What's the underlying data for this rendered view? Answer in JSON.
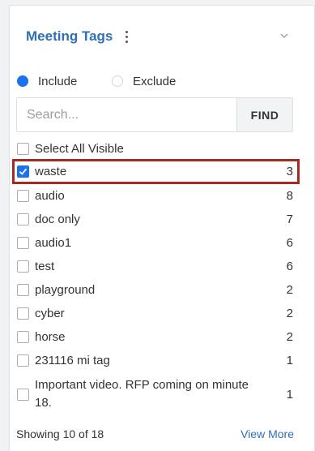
{
  "panel": {
    "title": "Meeting Tags",
    "kebab_icon": "vertical-ellipsis-icon",
    "collapse_icon": "chevron-down-icon"
  },
  "filter_mode": {
    "include_label": "Include",
    "exclude_label": "Exclude",
    "selected": "Include"
  },
  "search": {
    "placeholder": "Search...",
    "value": "",
    "find_label": "FIND"
  },
  "select_all_label": "Select All Visible",
  "tags": [
    {
      "name": "waste",
      "count": "3",
      "checked": true,
      "highlighted": true
    },
    {
      "name": "audio",
      "count": "8",
      "checked": false
    },
    {
      "name": "doc only",
      "count": "7",
      "checked": false
    },
    {
      "name": "audio1",
      "count": "6",
      "checked": false
    },
    {
      "name": "test",
      "count": "6",
      "checked": false
    },
    {
      "name": "playground",
      "count": "2",
      "checked": false
    },
    {
      "name": "cyber",
      "count": "2",
      "checked": false
    },
    {
      "name": "horse",
      "count": "2",
      "checked": false
    },
    {
      "name": "231116 mi tag",
      "count": "1",
      "checked": false
    },
    {
      "name": "Important video. RFP coming on minute 18.",
      "count": "1",
      "checked": false
    }
  ],
  "footer": {
    "showing": "Showing 10 of 18",
    "view_more": "View More"
  },
  "colors": {
    "accent": "#1a73e8",
    "title": "#2f6fb6",
    "highlight_border": "#a52a1f"
  }
}
